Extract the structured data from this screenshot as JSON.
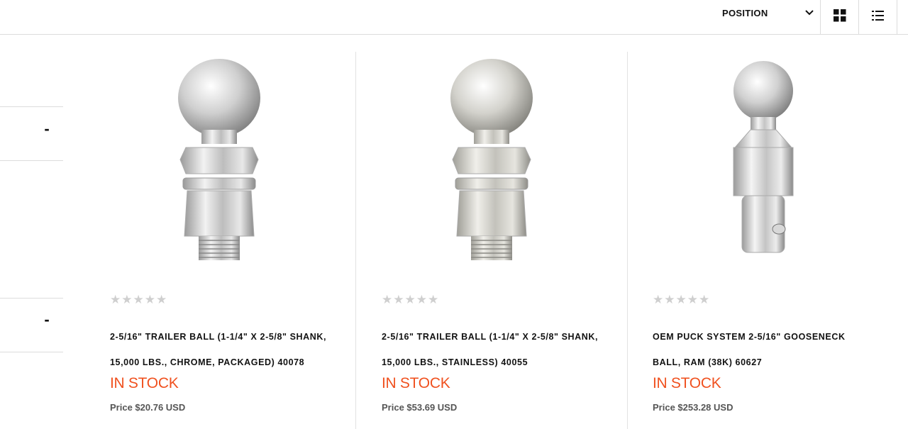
{
  "toolbar": {
    "sort_label": "POSITION",
    "sort_icon": "chevron-down-icon",
    "grid_icon": "grid-view-icon",
    "list_icon": "list-view-icon"
  },
  "filters": {
    "toggle_1": "-",
    "toggle_2": "-"
  },
  "products": [
    {
      "image_icon": "chrome-trailer-ball-image",
      "rating_stars": "★★★★★",
      "title_line_1": "2-5/16\" TRAILER BALL (1-1/4\" X 2-5/8\" SHANK,",
      "title_line_2": "15,000 LBS., CHROME, PACKAGED) 40078",
      "stock": "IN STOCK",
      "price": "Price $20.76 USD"
    },
    {
      "image_icon": "stainless-trailer-ball-image",
      "rating_stars": "★★★★★",
      "title_line_1": "2-5/16\" TRAILER BALL (1-1/4\" X 2-5/8\" SHANK,",
      "title_line_2": "15,000 LBS., STAINLESS) 40055",
      "stock": "IN STOCK",
      "price": "Price $53.69 USD"
    },
    {
      "image_icon": "gooseneck-ball-image",
      "rating_stars": "★★★★★",
      "title_line_1": "OEM PUCK SYSTEM 2-5/16\" GOOSENECK",
      "title_line_2": "BALL, RAM (38K) 60627",
      "stock": "IN STOCK",
      "price": "Price $253.28 USD"
    }
  ],
  "colors": {
    "stock": "#f0511f",
    "border": "#dcdcdc",
    "stars": "#cfcfcf"
  }
}
